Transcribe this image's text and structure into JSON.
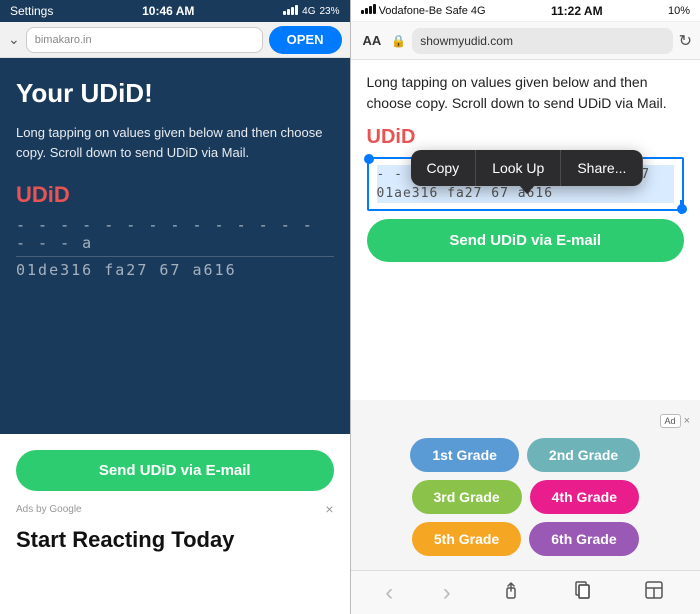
{
  "left": {
    "statusBar": {
      "left": "Settings",
      "time": "10:46 AM",
      "signal": "4G",
      "battery": "23%"
    },
    "browserBar": {
      "urlText": "bimakaro.in",
      "openButton": "OPEN"
    },
    "hero": {
      "title": "Your UDiD!",
      "description": "Long tapping on values given below and then choose copy. Scroll down to send UDiD via Mail.",
      "udidLabel": "UDiD",
      "udidRow1": "- - - - - - - - - - - - - - - - - a",
      "udidRow2": "01de316 fa27 67 a616"
    },
    "bottom": {
      "sendButton": "Send UDiD via E-mail",
      "adText": "Ads by Google",
      "adClose": "×",
      "startReacting": "Start Reacting Today"
    }
  },
  "right": {
    "statusBar": {
      "carrier": "Vodafone-Be Safe",
      "network": "4G",
      "time": "11:22 AM",
      "battery": "10%"
    },
    "browserBar": {
      "aa": "AA",
      "url": "showmyudid.com",
      "refresh": "↻"
    },
    "content": {
      "description": "Long tapping on values given below and then choose copy. Scroll down to send UDiD via Mail.",
      "udidLabel": "UDiD",
      "udidRow1": "- - - - - - - - - - - - - - d17",
      "udidRow2": "01ae316 fa27 67 a616"
    },
    "contextMenu": {
      "items": [
        "Copy",
        "Look Up",
        "Share..."
      ]
    },
    "sendButton": "Send UDiD via E-mail",
    "grades": {
      "adLabel": "Ad",
      "adClose": "×",
      "items": [
        {
          "label": "1st Grade",
          "class": "grade-1"
        },
        {
          "label": "2nd Grade",
          "class": "grade-2"
        },
        {
          "label": "3rd Grade",
          "class": "grade-3"
        },
        {
          "label": "4th Grade",
          "class": "grade-4"
        },
        {
          "label": "5th Grade",
          "class": "grade-5"
        },
        {
          "label": "6th Grade",
          "class": "grade-6"
        }
      ]
    },
    "toolbar": {
      "back": "‹",
      "forward": "›",
      "share": "⬆",
      "bookmarks": "□",
      "tabs": "⊞"
    }
  }
}
